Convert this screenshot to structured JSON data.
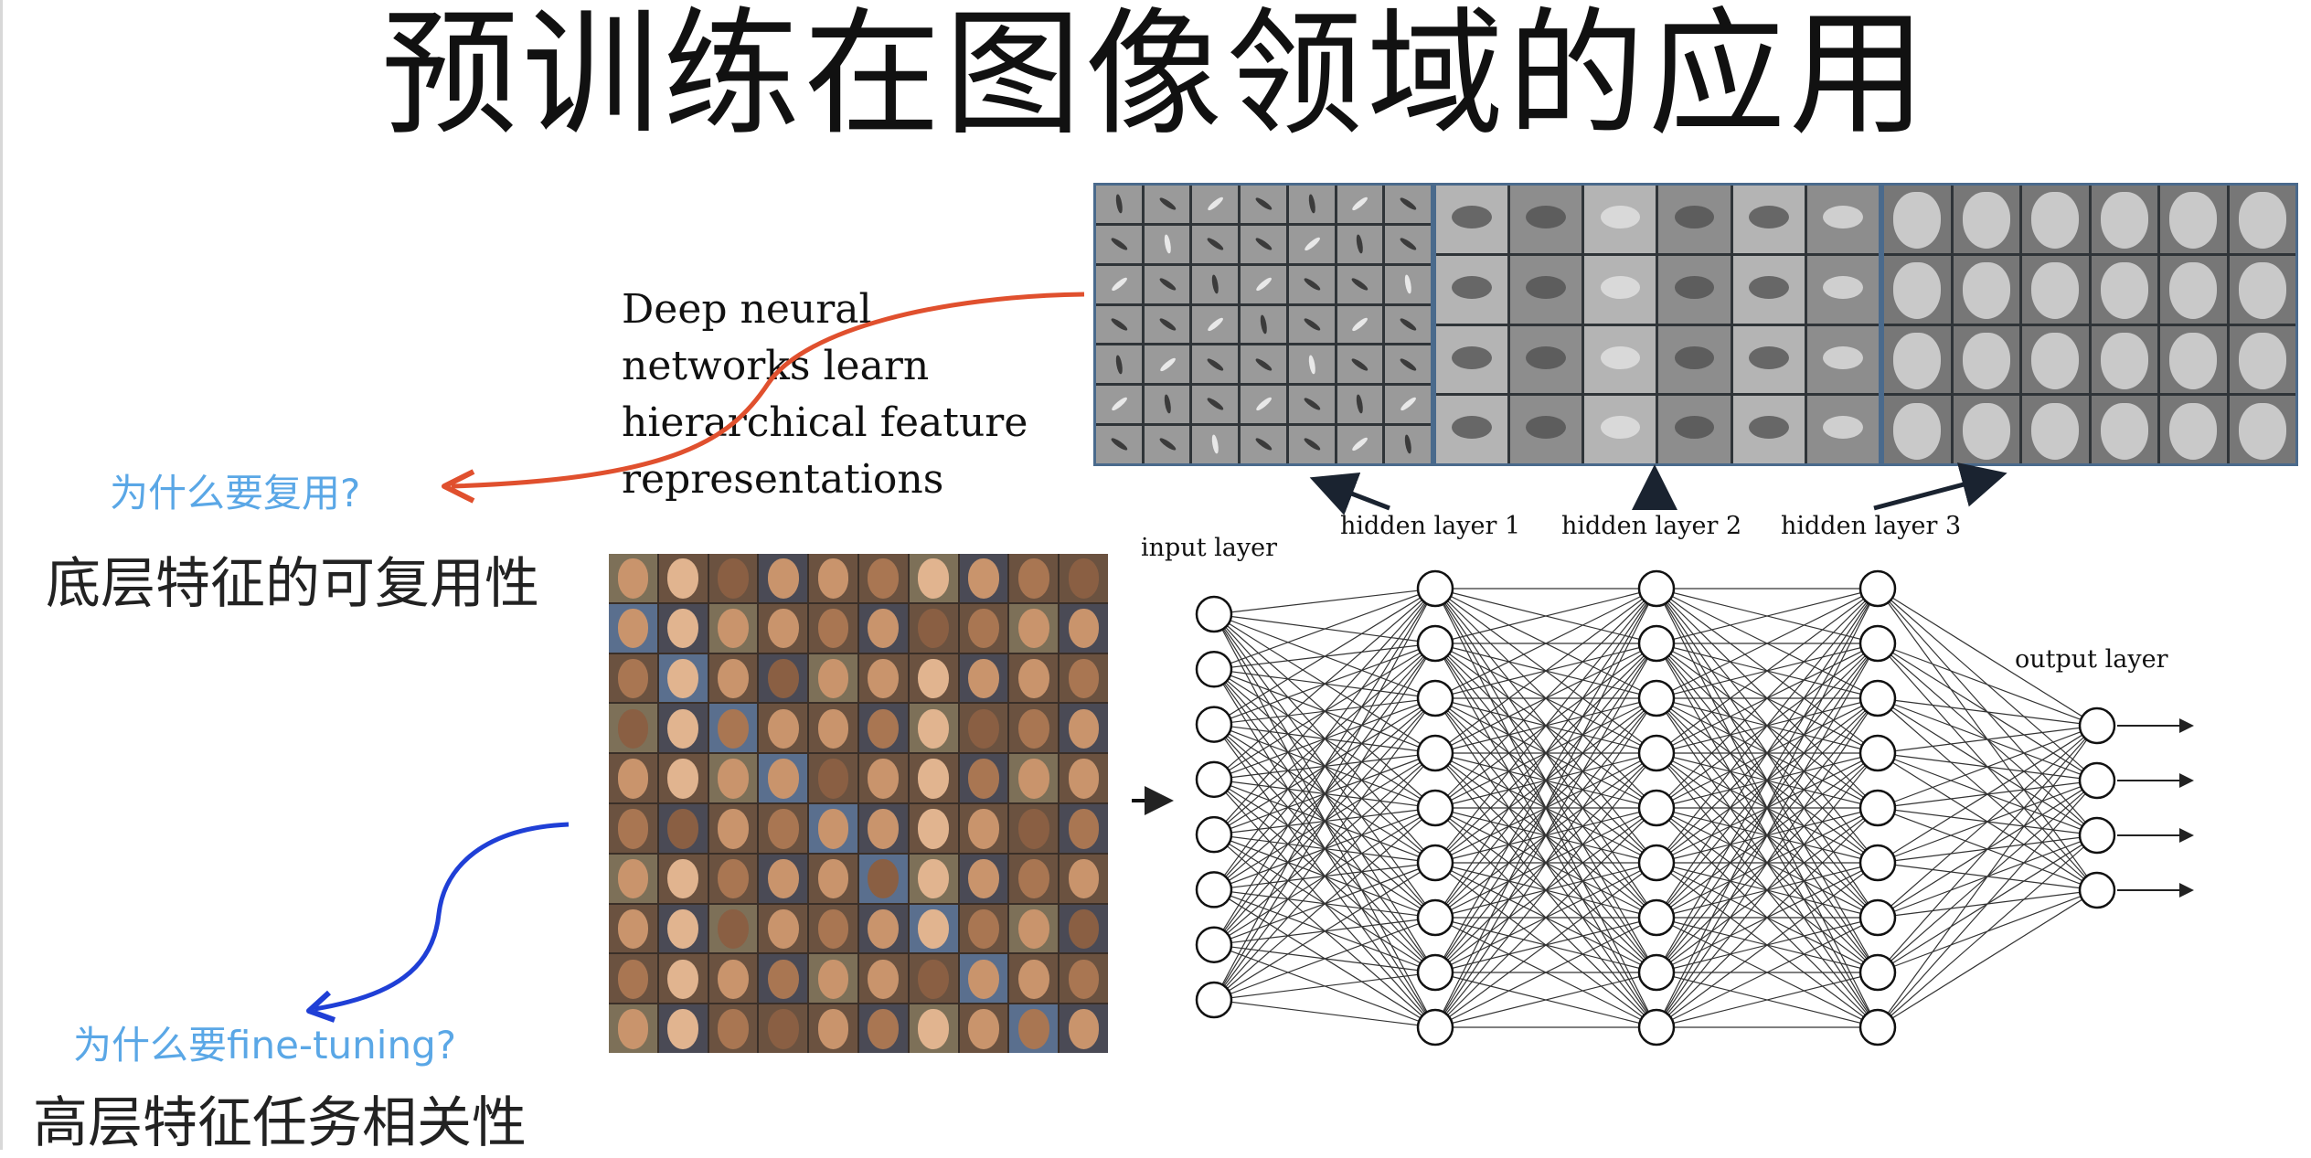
{
  "slide": {
    "title": "预训练在图像领域的应用",
    "quote": [
      "Deep neural",
      "networks learn",
      "hierarchical feature",
      "representations"
    ],
    "question_reuse": "为什么要复用?",
    "statement_reuse": "底层特征的可复用性",
    "question_finetune": "为什么要fine-tuning?",
    "statement_finetune": "高层特征任务相关性"
  },
  "network": {
    "input_label": "input layer",
    "output_label": "output layer",
    "hidden_labels": [
      "hidden layer 1",
      "hidden layer 2",
      "hidden layer 3"
    ],
    "layer_sizes": [
      8,
      9,
      9,
      9,
      4
    ]
  },
  "colors": {
    "title": "#111111",
    "question_text": "#5aa7e6",
    "red_arrow": "#e0502e",
    "blue_arrow": "#1f3fd6",
    "strip_border": "#4a6a8c"
  }
}
